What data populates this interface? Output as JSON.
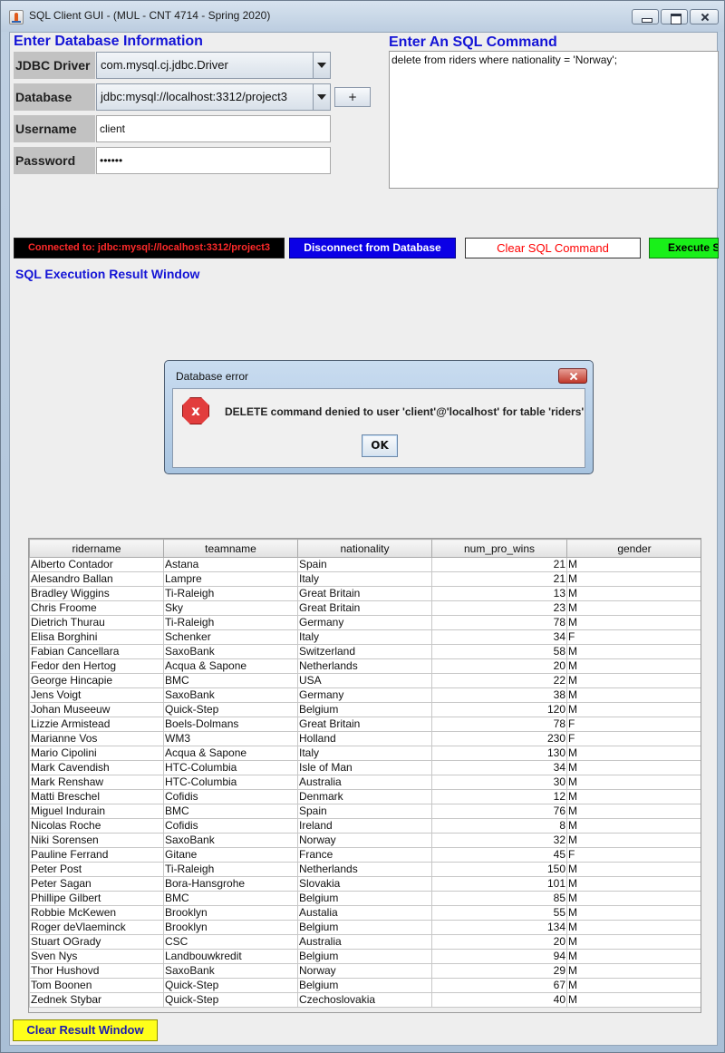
{
  "window": {
    "title": "SQL Client GUI - (MUL - CNT 4714 - Spring 2020)"
  },
  "db_info": {
    "heading": "Enter Database Information",
    "driver_label": "JDBC Driver",
    "driver_value": "com.mysql.cj.jdbc.Driver",
    "url_label": "Database URL",
    "url_value": "jdbc:mysql://localhost:3312/project3",
    "plus_label": "+",
    "username_label": "Username",
    "username_value": "client",
    "password_label": "Password",
    "password_value": "••••••"
  },
  "sql": {
    "heading": "Enter An SQL Command",
    "command": "delete from riders where nationality = 'Norway';"
  },
  "actions": {
    "status": "Connected to: jdbc:mysql://localhost:3312/project3",
    "disconnect": "Disconnect from Database",
    "clear_sql": "Clear SQL Command",
    "execute": "Execute SQL Command"
  },
  "result": {
    "heading": "SQL Execution Result Window",
    "columns": [
      "ridername",
      "teamname",
      "nationality",
      "num_pro_wins",
      "gender"
    ],
    "rows": [
      [
        "Alberto Contador",
        "Astana",
        "Spain",
        "21",
        "M"
      ],
      [
        "Alesandro Ballan",
        "Lampre",
        "Italy",
        "21",
        "M"
      ],
      [
        "Bradley Wiggins",
        "Ti-Raleigh",
        "Great Britain",
        "13",
        "M"
      ],
      [
        "Chris Froome",
        "Sky",
        "Great Britain",
        "23",
        "M"
      ],
      [
        "Dietrich Thurau",
        "Ti-Raleigh",
        "Germany",
        "78",
        "M"
      ],
      [
        "Elisa Borghini",
        "Schenker",
        "Italy",
        "34",
        "F"
      ],
      [
        "Fabian Cancellara",
        "SaxoBank",
        "Switzerland",
        "58",
        "M"
      ],
      [
        "Fedor den Hertog",
        "Acqua & Sapone",
        "Netherlands",
        "20",
        "M"
      ],
      [
        "George Hincapie",
        "BMC",
        "USA",
        "22",
        "M"
      ],
      [
        "Jens Voigt",
        "SaxoBank",
        "Germany",
        "38",
        "M"
      ],
      [
        "Johan Museeuw",
        "Quick-Step",
        "Belgium",
        "120",
        "M"
      ],
      [
        "Lizzie Armistead",
        "Boels-Dolmans",
        "Great Britain",
        "78",
        "F"
      ],
      [
        "Marianne Vos",
        "WM3",
        "Holland",
        "230",
        "F"
      ],
      [
        "Mario Cipolini",
        "Acqua & Sapone",
        "Italy",
        "130",
        "M"
      ],
      [
        "Mark Cavendish",
        "HTC-Columbia",
        "Isle of Man",
        "34",
        "M"
      ],
      [
        "Mark Renshaw",
        "HTC-Columbia",
        "Australia",
        "30",
        "M"
      ],
      [
        "Matti Breschel",
        "Cofidis",
        "Denmark",
        "12",
        "M"
      ],
      [
        "Miguel Indurain",
        "BMC",
        "Spain",
        "76",
        "M"
      ],
      [
        "Nicolas Roche",
        "Cofidis",
        "Ireland",
        "8",
        "M"
      ],
      [
        "Niki Sorensen",
        "SaxoBank",
        "Norway",
        "32",
        "M"
      ],
      [
        "Pauline Ferrand",
        "Gitane",
        "France",
        "45",
        "F"
      ],
      [
        "Peter Post",
        "Ti-Raleigh",
        "Netherlands",
        "150",
        "M"
      ],
      [
        "Peter Sagan",
        "Bora-Hansgrohe",
        "Slovakia",
        "101",
        "M"
      ],
      [
        "Phillipe Gilbert",
        "BMC",
        "Belgium",
        "85",
        "M"
      ],
      [
        "Robbie McKewen",
        "Brooklyn",
        "Austalia",
        "55",
        "M"
      ],
      [
        "Roger deVlaeminck",
        "Brooklyn",
        "Belgium",
        "134",
        "M"
      ],
      [
        "Stuart OGrady",
        "CSC",
        "Australia",
        "20",
        "M"
      ],
      [
        "Sven Nys",
        "Landbouwkredit",
        "Belgium",
        "94",
        "M"
      ],
      [
        "Thor Hushovd",
        "SaxoBank",
        "Norway",
        "29",
        "M"
      ],
      [
        "Tom Boonen",
        "Quick-Step",
        "Belgium",
        "67",
        "M"
      ],
      [
        "Zednek Stybar",
        "Quick-Step",
        "Czechoslovakia",
        "40",
        "M"
      ]
    ],
    "clear_label": "Clear Result Window"
  },
  "dialog": {
    "title": "Database error",
    "icon_glyph": "x",
    "message": "DELETE command denied to user 'client'@'localhost' for table 'riders'",
    "ok_label": "OK"
  },
  "colors": {
    "heading_blue": "#1414d6",
    "status_bg": "#000000",
    "status_text": "#ff2a2a",
    "disconnect_bg": "#0b00e6",
    "clear_sql_text": "#ff0000",
    "execute_bg": "#19f019",
    "clear_result_bg": "#ffff1a",
    "error_red": "#e23d3d"
  }
}
